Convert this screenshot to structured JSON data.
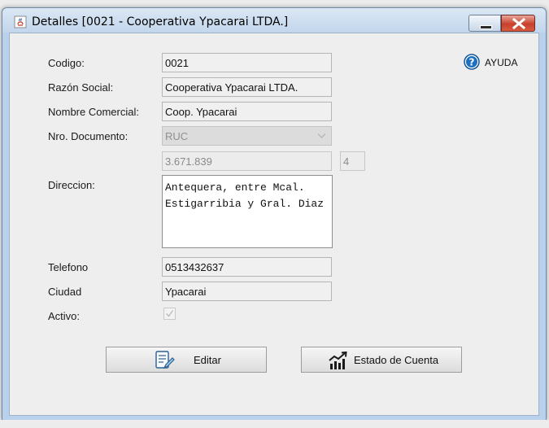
{
  "window": {
    "title": "Detalles [0021 - Cooperativa Ypacarai LTDA.]",
    "app_icon": "java-cup-icon",
    "controls": {
      "minimize": "minimize-icon",
      "close": "close-icon"
    }
  },
  "help": {
    "label": "AYUDA",
    "icon": "question-circle-icon"
  },
  "form": {
    "codigo": {
      "label": "Codigo:",
      "value": "0021"
    },
    "razon_social": {
      "label": "Razón Social:",
      "value": "Cooperativa Ypacarai LTDA."
    },
    "nombre_comercial": {
      "label": "Nombre Comercial:",
      "value": "Coop. Ypacarai"
    },
    "nro_documento": {
      "label": "Nro. Documento:",
      "type_value": "RUC",
      "number": "3.671.839",
      "dv": "4"
    },
    "direccion": {
      "label": "Direccion:",
      "value": "Antequera, entre Mcal.\nEstigarribia y Gral. Diaz"
    },
    "telefono": {
      "label": "Telefono",
      "value": "0513432637"
    },
    "ciudad": {
      "label": "Ciudad",
      "value": "Ypacarai"
    },
    "activo": {
      "label": "Activo:",
      "checked": true
    }
  },
  "buttons": {
    "editar": {
      "label": "Editar",
      "icon": "edit-document-icon"
    },
    "estado_cuenta": {
      "label": "Estado de Cuenta",
      "icon": "bar-chart-trend-icon"
    }
  },
  "colors": {
    "title_bar": "#c2d6ec",
    "panel": "#eeeeee",
    "help_blue": "#1e6fbf",
    "close_red": "#c9402c"
  }
}
